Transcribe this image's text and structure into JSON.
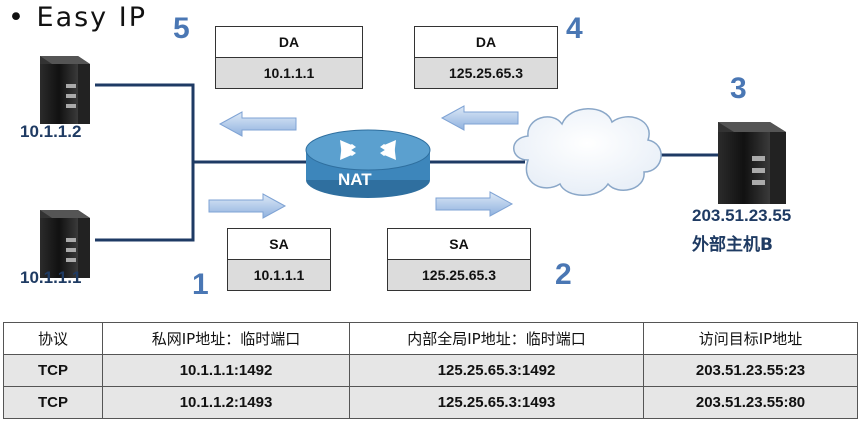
{
  "title": "• Easy IP",
  "step_numbers": {
    "s1": "1",
    "s2": "2",
    "s3": "3",
    "s4": "4",
    "s5": "5"
  },
  "hosts": {
    "host_a": "10.1.1.2",
    "host_b": "10.1.1.1",
    "server_ip": "203.51.23.55",
    "server_name": "外部主机B"
  },
  "router_label": "NAT",
  "packets": {
    "p5": {
      "header": "DA",
      "value": "10.1.1.1"
    },
    "p4": {
      "header": "DA",
      "value": "125.25.65.3"
    },
    "p1": {
      "header": "SA",
      "value": "10.1.1.1"
    },
    "p2": {
      "header": "SA",
      "value": "125.25.65.3"
    }
  },
  "table": {
    "headers": [
      "协议",
      "私网IP地址：临时端口",
      "内部全局IP地址：临时端口",
      "访问目标IP地址"
    ],
    "rows": [
      [
        "TCP",
        "10.1.1.1:1492",
        "125.25.65.3:1492",
        "203.51.23.55:23"
      ],
      [
        "TCP",
        "10.1.1.2:1493",
        "125.25.65.3:1493",
        "203.51.23.55:80"
      ]
    ]
  }
}
